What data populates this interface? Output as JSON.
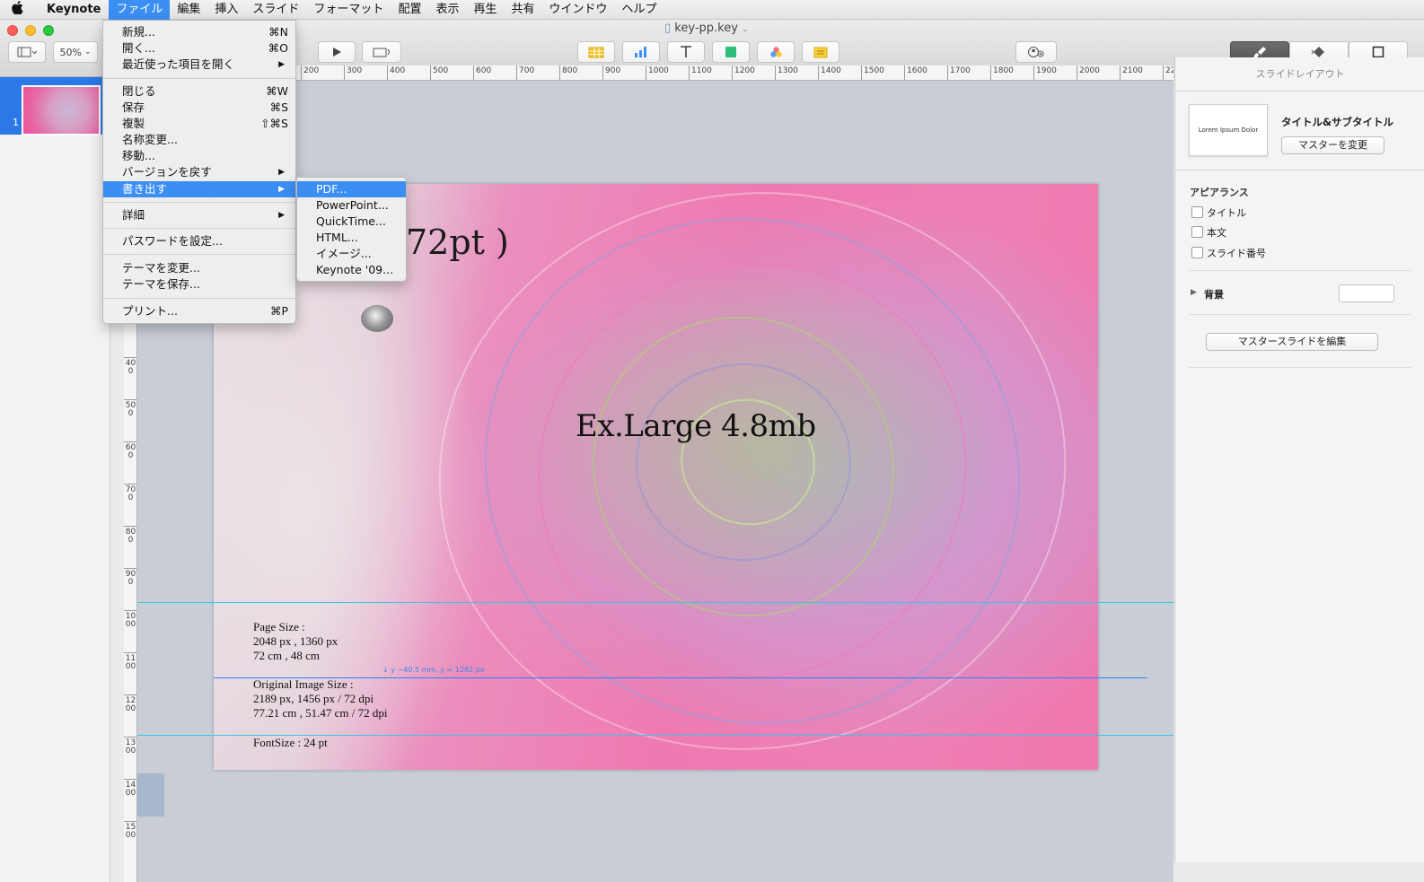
{
  "menubar": {
    "apple": "",
    "app": "Keynote",
    "items": [
      "ファイル",
      "編集",
      "挿入",
      "スライド",
      "フォーマット",
      "配置",
      "表示",
      "再生",
      "共有",
      "ウインドウ",
      "ヘルプ"
    ]
  },
  "window": {
    "doc_title": "key-pp.key",
    "zoom": "50%"
  },
  "navigator": {
    "slide_number": "1"
  },
  "ruler": {
    "h_ticks": [
      "200",
      "300",
      "400",
      "500",
      "600",
      "700",
      "800",
      "900",
      "1000",
      "1100",
      "1200",
      "1300",
      "1400",
      "1500",
      "1600",
      "1700",
      "1800",
      "1900",
      "2000",
      "2100",
      "22"
    ],
    "v_ticks": [
      "400",
      "500",
      "600",
      "700",
      "800",
      "900",
      "1000",
      "1100",
      "1200",
      "1300",
      "1400",
      "1500"
    ]
  },
  "file_menu": {
    "new": {
      "label": "新規...",
      "shortcut": "⌘N"
    },
    "open": {
      "label": "開く...",
      "shortcut": "⌘O"
    },
    "recent": {
      "label": "最近使った項目を開く"
    },
    "close": {
      "label": "閉じる",
      "shortcut": "⌘W"
    },
    "save": {
      "label": "保存",
      "shortcut": "⌘S"
    },
    "duplicate": {
      "label": "複製",
      "shortcut": "⇧⌘S"
    },
    "rename": {
      "label": "名称変更..."
    },
    "move": {
      "label": "移動..."
    },
    "revert": {
      "label": "バージョンを戻す"
    },
    "export": {
      "label": "書き出す"
    },
    "advanced": {
      "label": "詳細"
    },
    "password": {
      "label": "パスワードを設定..."
    },
    "change_theme": {
      "label": "テーマを変更..."
    },
    "save_theme": {
      "label": "テーマを保存..."
    },
    "print": {
      "label": "プリント...",
      "shortcut": "⌘P"
    }
  },
  "export_menu": [
    "PDF...",
    "PowerPoint...",
    "QuickTime...",
    "HTML...",
    "イメージ...",
    "Keynote '09..."
  ],
  "slide": {
    "peek_title": "72pt )",
    "main_text": "Ex.Large 4.8mb",
    "caption_lines": [
      "Page Size :",
      "2048 px , 1360 px",
      "72 cm , 48 cm",
      "Original Image Size :",
      "2189 px, 1456 px / 72 dpi",
      "77.21 cm , 51.47 cm / 72 dpi",
      "FontSize : 24 pt"
    ],
    "guide_label": "↓ y −40.5 mm, y = 1282 px"
  },
  "inspector": {
    "header": "スライドレイアウト",
    "master_preview_text": "Lorem Ipsum Dolor",
    "master_name": "タイトル&サブタイトル",
    "change_master": "マスターを変更",
    "appearance_heading": "アピアランス",
    "appearance": [
      "タイトル",
      "本文",
      "スライド番号"
    ],
    "background_label": "背景",
    "edit_master": "マスタースライドを編集"
  },
  "colors": {
    "accent": "#3b8ef3",
    "slide_pink": "#f05fa3",
    "guide": "#39c6e6"
  }
}
